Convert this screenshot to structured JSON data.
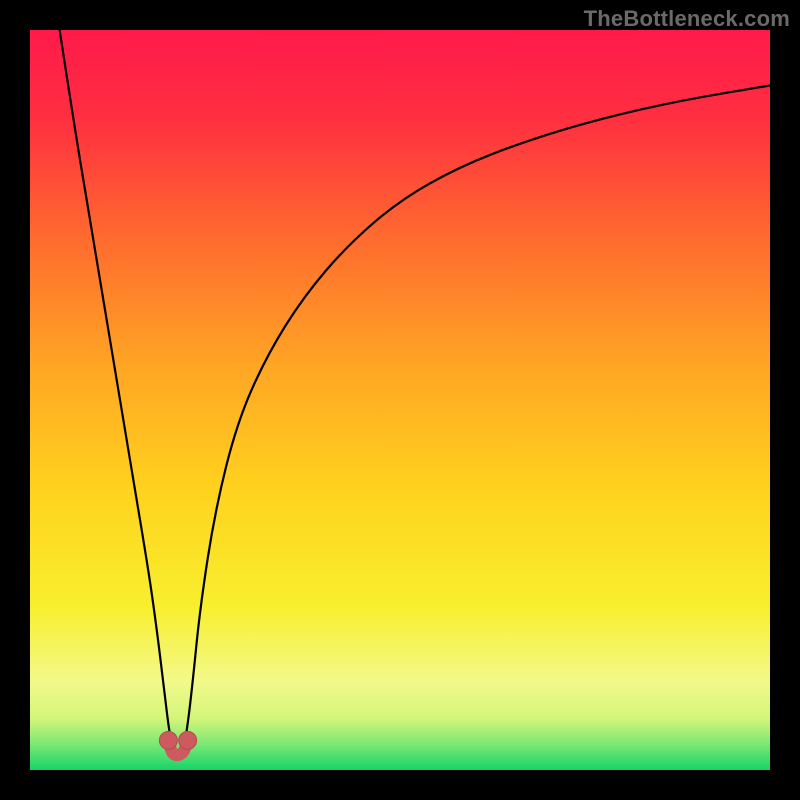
{
  "watermark": "TheBottleneck.com",
  "chart_data": {
    "type": "line",
    "title": "",
    "xlabel": "",
    "ylabel": "",
    "xlim": [
      0,
      100
    ],
    "ylim": [
      0,
      100
    ],
    "grid": false,
    "legend": false,
    "background_gradient_stops": [
      {
        "offset": 0.0,
        "color": "#ff1a4b"
      },
      {
        "offset": 0.12,
        "color": "#ff2f40"
      },
      {
        "offset": 0.28,
        "color": "#ff6a2f"
      },
      {
        "offset": 0.45,
        "color": "#ffa424"
      },
      {
        "offset": 0.62,
        "color": "#ffd21e"
      },
      {
        "offset": 0.78,
        "color": "#f8ef2e"
      },
      {
        "offset": 0.88,
        "color": "#f3f98a"
      },
      {
        "offset": 0.93,
        "color": "#d4f57a"
      },
      {
        "offset": 0.965,
        "color": "#7ce874"
      },
      {
        "offset": 1.0,
        "color": "#17d46a"
      }
    ],
    "series": [
      {
        "name": "bottleneck-curve",
        "color": "#000000",
        "x": [
          4,
          6,
          8,
          10,
          12,
          14,
          16,
          17,
          18,
          18.7,
          19.3,
          20,
          20.7,
          21.3,
          22,
          23,
          25,
          28,
          32,
          37,
          43,
          50,
          58,
          67,
          77,
          88,
          100
        ],
        "values": [
          100,
          87,
          75,
          63,
          51,
          39,
          27,
          20,
          12,
          6,
          2.5,
          2,
          2.5,
          6,
          12,
          22,
          35,
          47,
          56,
          64,
          71,
          77,
          81.5,
          85,
          88,
          90.5,
          92.5
        ]
      }
    ],
    "marker": {
      "name": "optimal-point",
      "color": "#cc5a5f",
      "stroke": "#b74a50",
      "x": [
        18.7,
        19.0,
        19.3,
        19.7,
        20.0,
        20.3,
        20.7,
        21.0,
        21.3
      ],
      "values": [
        4.0,
        2.8,
        2.2,
        2.0,
        2.0,
        2.1,
        2.4,
        3.0,
        4.0
      ],
      "endpoint_radius": 9,
      "mid_line_width": 12
    }
  }
}
